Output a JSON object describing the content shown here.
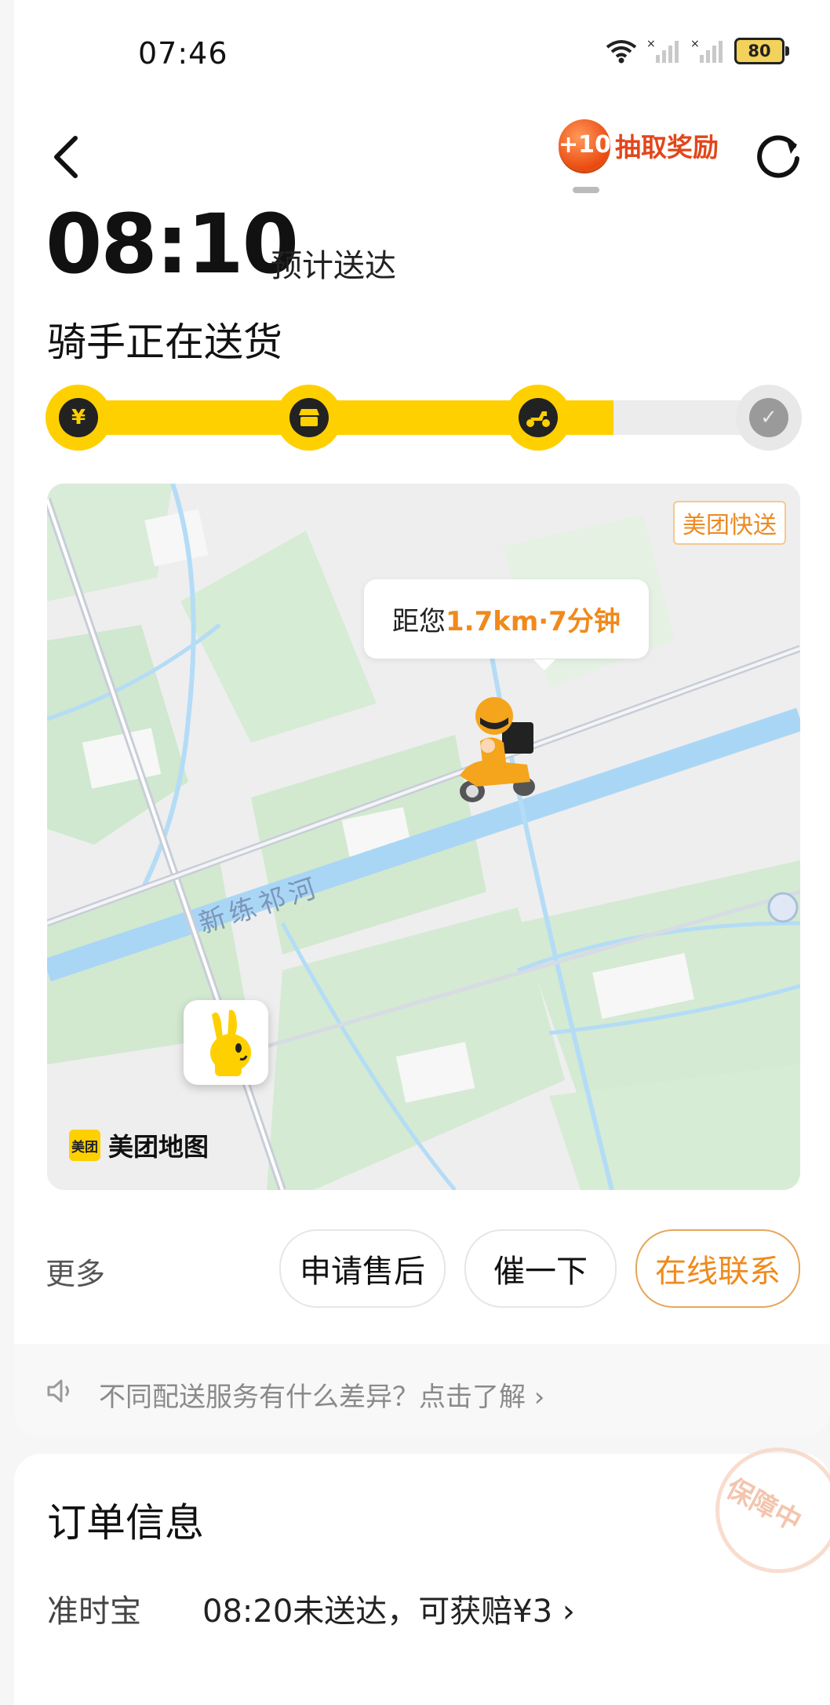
{
  "status_bar": {
    "time": "07:46",
    "battery": "80"
  },
  "header": {
    "reward_badge": "+10",
    "reward_label": "抽取奖励"
  },
  "eta": {
    "time": "08:10",
    "label": "预计送达"
  },
  "delivery_status": "骑手正在送货",
  "progress": {
    "steps": [
      "paid",
      "store",
      "rider",
      "delivered"
    ],
    "current_step": 3,
    "fill_fraction": 0.72
  },
  "map": {
    "brand_tag": "美团快送",
    "bubble_prefix": "距您",
    "bubble_highlight": "1.7km·7分钟",
    "river_label": "新练祁河",
    "logo_mark": "美团",
    "logo_text": "美团地图"
  },
  "actions": {
    "more_label": "更多",
    "after_sale": "申请售后",
    "urge": "催一下",
    "contact": "在线联系"
  },
  "notice": {
    "text": "不同配送服务有什么差异？点击了解 ›"
  },
  "order_info": {
    "title": "订单信息",
    "stamp": "保障中",
    "rows": [
      {
        "key": "准时宝",
        "value": "08:20未送达，可获赔¥3 ›"
      }
    ]
  },
  "colors": {
    "accent_yellow": "#ffd000",
    "accent_orange": "#f08a1c",
    "reward_red": "#e2461a"
  }
}
